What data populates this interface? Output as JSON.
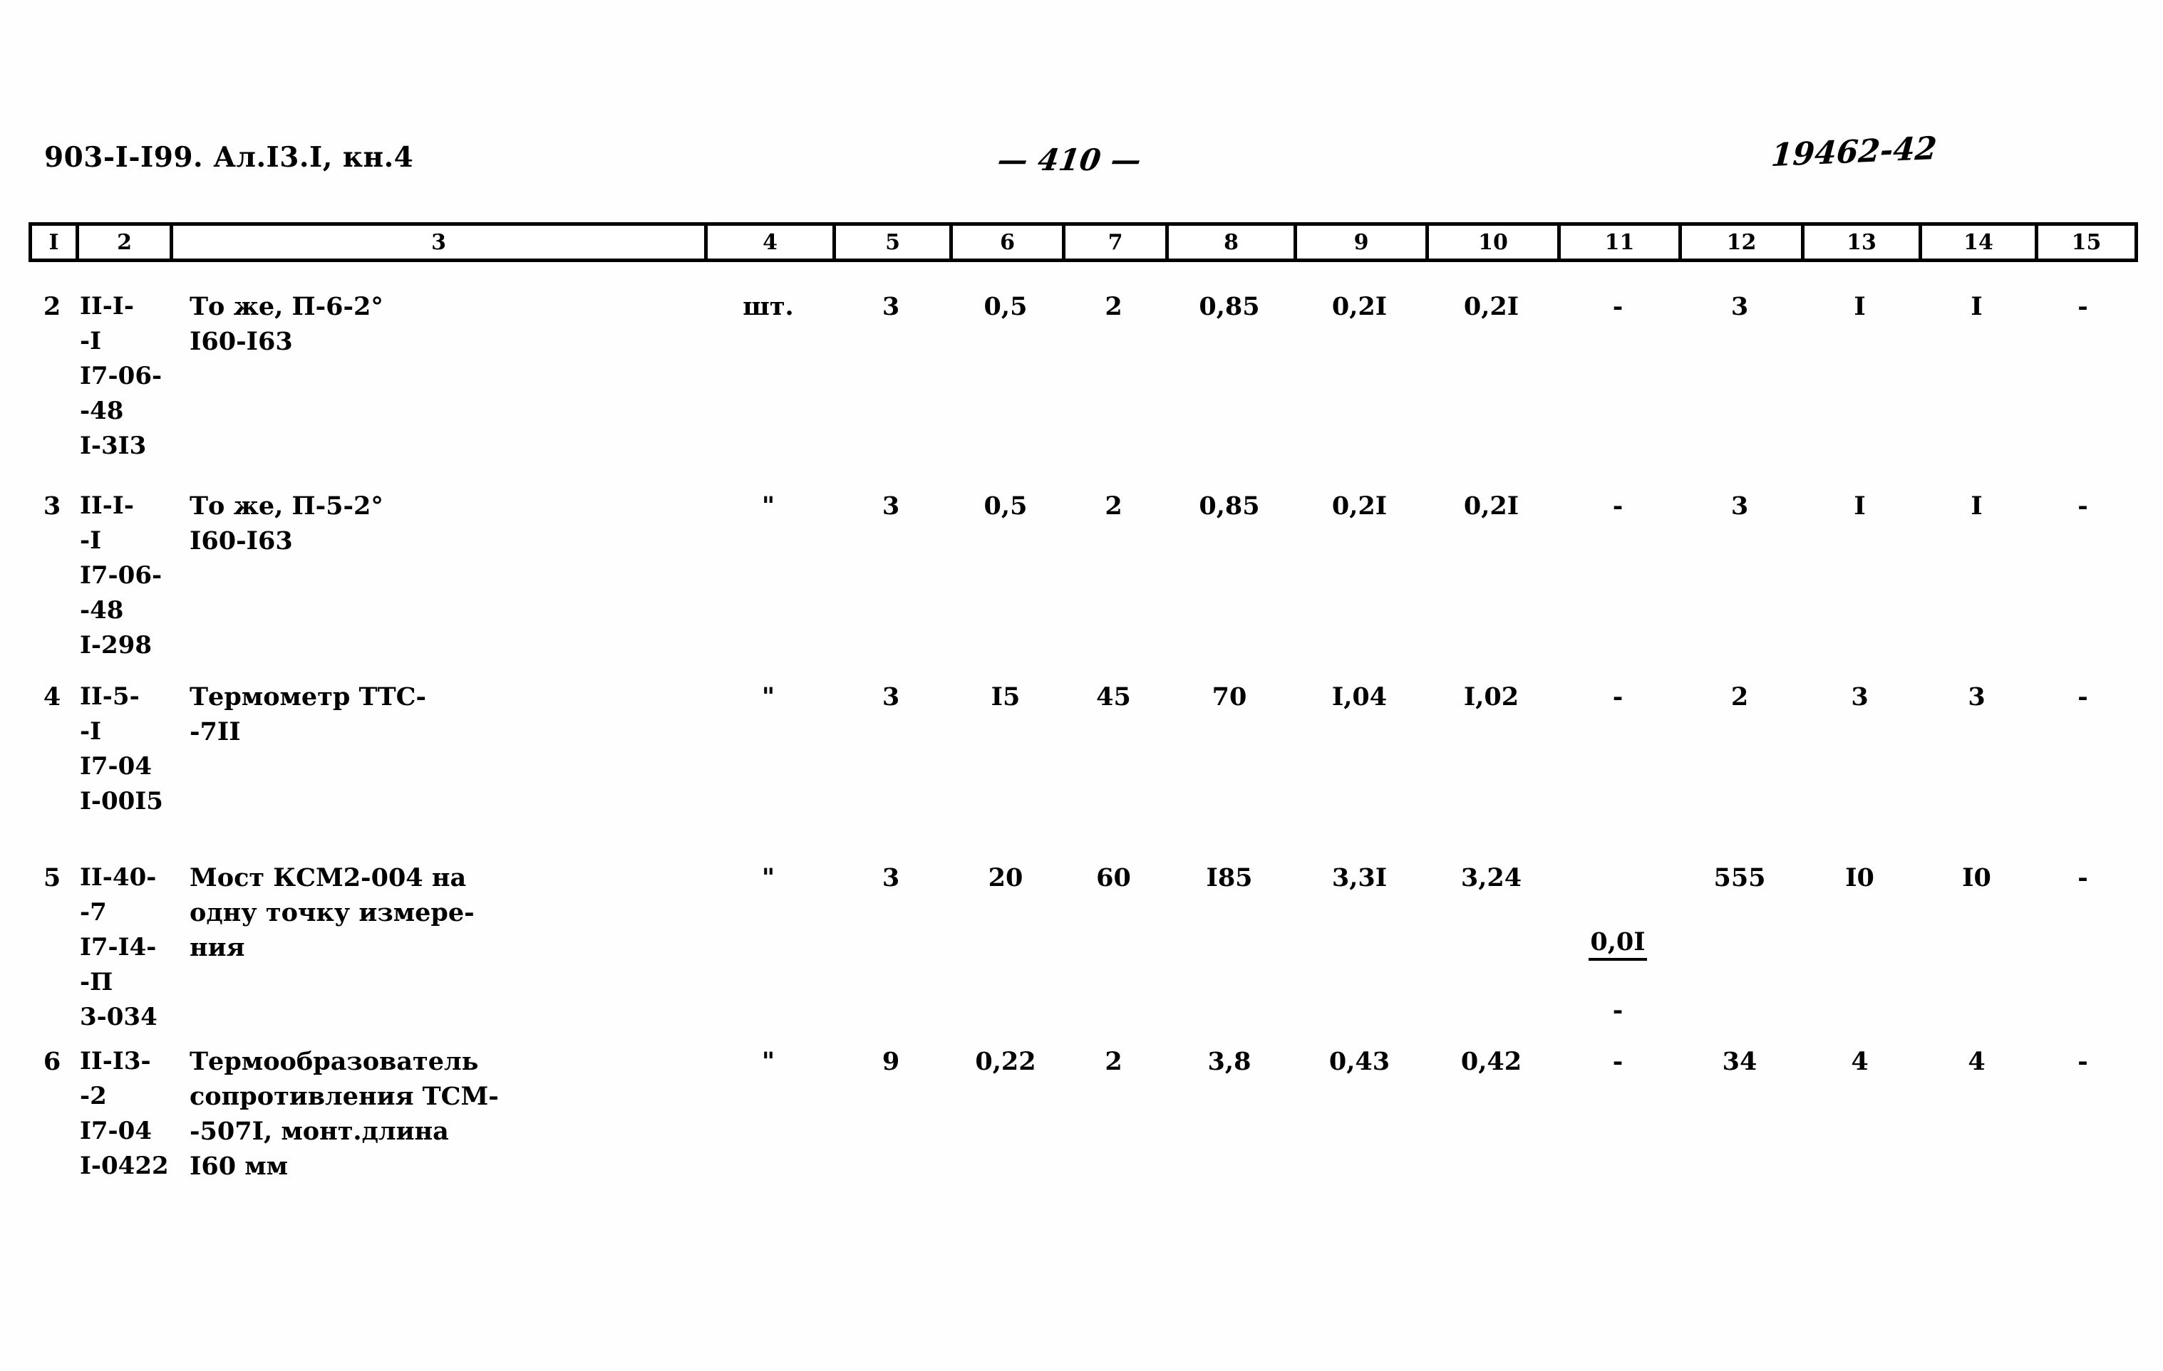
{
  "header": {
    "doc_code": "903-I-I99. Ал.I3.I, кн.4",
    "page_number": "— 410 —",
    "stamp_number": "19462-42"
  },
  "table": {
    "column_headers": [
      "I",
      "2",
      "3",
      "4",
      "5",
      "6",
      "7",
      "8",
      "9",
      "10",
      "11",
      "12",
      "13",
      "14",
      "15"
    ],
    "rows": [
      {
        "num": "2",
        "code": "II-I-\n-I\nI7-06-\n-48\nI-3I3",
        "description": "То же, П-6-2°\nI60-I63",
        "unit": "шт.",
        "c5": "3",
        "c6": "0,5",
        "c7": "2",
        "c8": "0,85",
        "c9": "0,2I",
        "c10": "0,2I",
        "c11": "-",
        "c12": "3",
        "c13": "I",
        "c14": "I",
        "c15": "-"
      },
      {
        "num": "3",
        "code": "II-I-\n-I\nI7-06-\n-48\nI-298",
        "description": "То же, П-5-2°\nI60-I63",
        "unit": "\"",
        "c5": "3",
        "c6": "0,5",
        "c7": "2",
        "c8": "0,85",
        "c9": "0,2I",
        "c10": "0,2I",
        "c11": "-",
        "c12": "3",
        "c13": "I",
        "c14": "I",
        "c15": "-"
      },
      {
        "num": "4",
        "code": "II-5-\n-I\nI7-04\nI-00I5",
        "description": "Термометр ТТС-\n-7II",
        "unit": "\"",
        "c5": "3",
        "c6": "I5",
        "c7": "45",
        "c8": "70",
        "c9": "I,04",
        "c10": "I,02",
        "c11": "-",
        "c12": "2",
        "c13": "3",
        "c14": "3",
        "c15": "-"
      },
      {
        "num": "5",
        "code": "II-40-\n-7\nI7-I4-\n-П\n3-034",
        "description": "Мост КСМ2-004 на\nодну точку измере-\nния",
        "unit": "\"",
        "c5": "3",
        "c6": "20",
        "c7": "60",
        "c8": "I85",
        "c9": "3,3I",
        "c10": "3,24",
        "c11_numerator": "0,0I",
        "c11_denominator": "-",
        "c12": "555",
        "c13": "I0",
        "c14": "I0",
        "c15": "-"
      },
      {
        "num": "6",
        "code": "II-I3-\n-2\nI7-04\nI-0422",
        "description": "Термообразователь\nсопротивления ТСМ-\n-507I, монт.длина\nI60 мм",
        "unit": "\"",
        "c5": "9",
        "c6": "0,22",
        "c7": "2",
        "c8": "3,8",
        "c9": "0,43",
        "c10": "0,42",
        "c11": "-",
        "c12": "34",
        "c13": "4",
        "c14": "4",
        "c15": "-"
      }
    ]
  }
}
